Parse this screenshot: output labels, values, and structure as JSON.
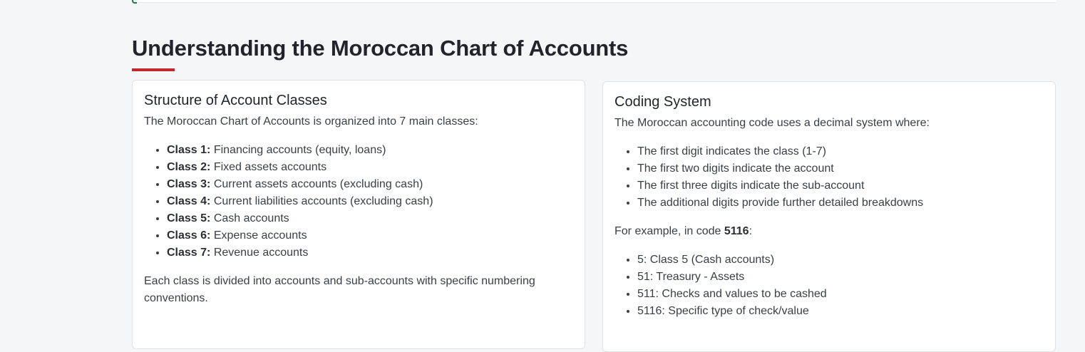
{
  "section": {
    "title": "Understanding the Moroccan Chart of Accounts",
    "accent_color": "#c1272d"
  },
  "left_card": {
    "heading": "Structure of Account Classes",
    "intro": "The Moroccan Chart of Accounts is organized into 7 main classes:",
    "classes": [
      {
        "label": "Class 1:",
        "desc": " Financing accounts (equity, loans)"
      },
      {
        "label": "Class 2:",
        "desc": " Fixed assets accounts"
      },
      {
        "label": "Class 3:",
        "desc": " Current assets accounts (excluding cash)"
      },
      {
        "label": "Class 4:",
        "desc": " Current liabilities accounts (excluding cash)"
      },
      {
        "label": "Class 5:",
        "desc": " Cash accounts"
      },
      {
        "label": "Class 6:",
        "desc": " Expense accounts"
      },
      {
        "label": "Class 7:",
        "desc": " Revenue accounts"
      }
    ],
    "outro": "Each class is divided into accounts and sub-accounts with specific numbering conventions."
  },
  "right_card": {
    "heading": "Coding System",
    "intro": "The Moroccan accounting code uses a decimal system where:",
    "rules": [
      "The first digit indicates the class (1-7)",
      "The first two digits indicate the account",
      "The first three digits indicate the sub-account",
      "The additional digits provide further detailed breakdowns"
    ],
    "example_prefix": "For example, in code ",
    "example_code": "5116",
    "example_suffix": ":",
    "example_items": [
      "5: Class 5 (Cash accounts)",
      "51: Treasury - Assets",
      "511: Checks and values to be cashed",
      "5116: Specific type of check/value"
    ]
  }
}
